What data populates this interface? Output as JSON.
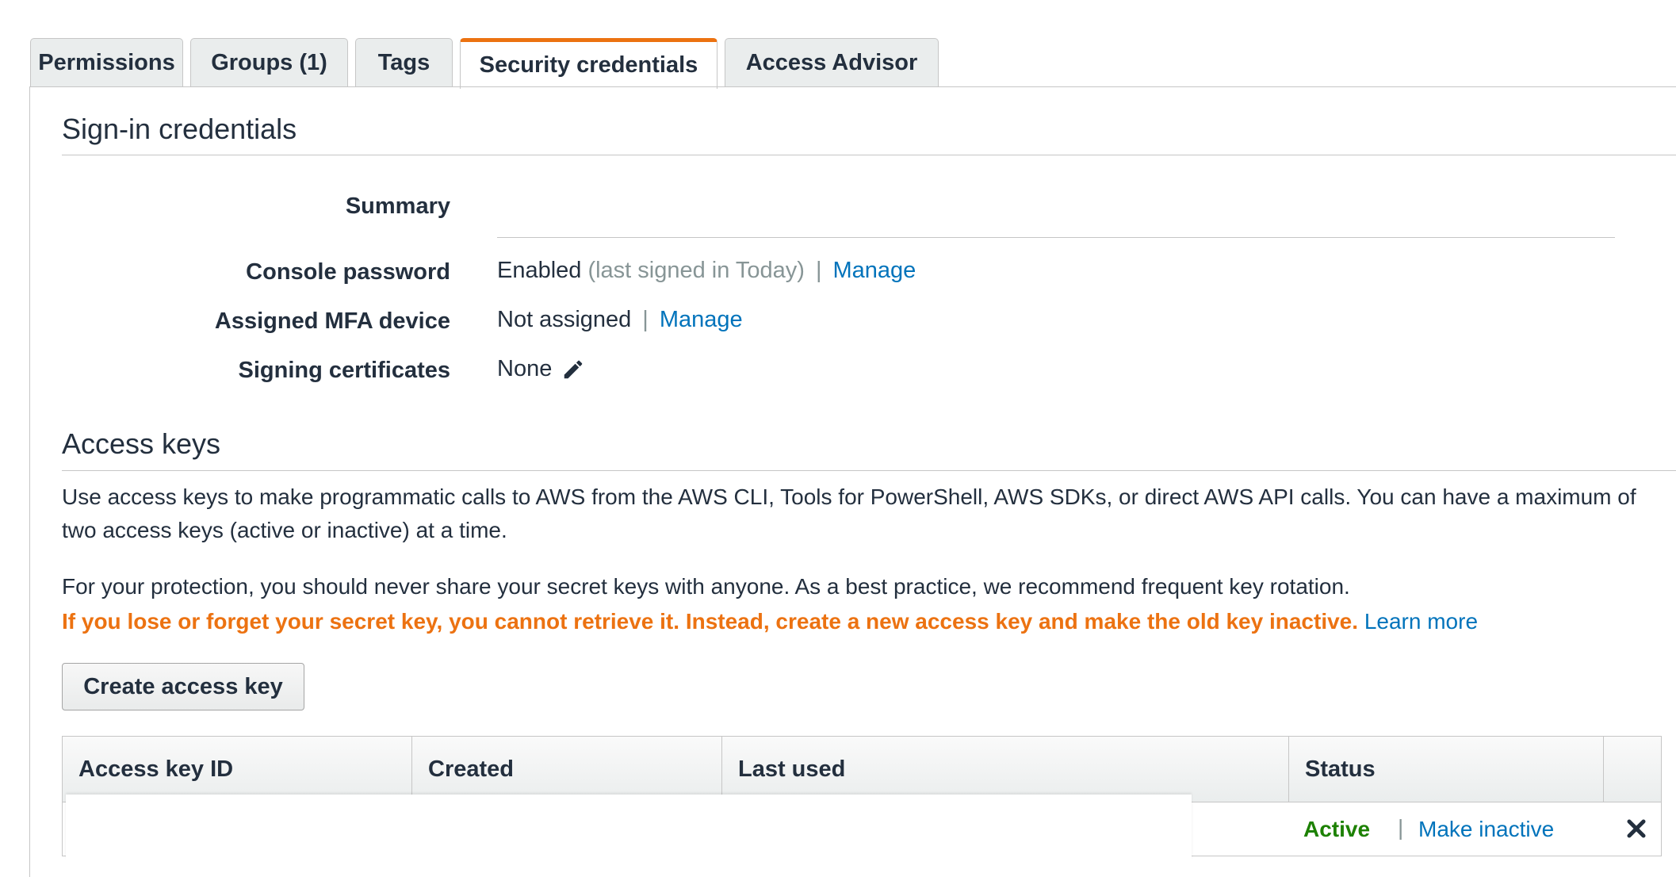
{
  "tabs": [
    {
      "label": "Permissions",
      "active": false
    },
    {
      "label": "Groups (1)",
      "active": false
    },
    {
      "label": "Tags",
      "active": false
    },
    {
      "label": "Security credentials",
      "active": true
    },
    {
      "label": "Access Advisor",
      "active": false
    }
  ],
  "sign_in": {
    "heading": "Sign-in credentials",
    "summary_label": "Summary",
    "console_password": {
      "label": "Console password",
      "value": "Enabled",
      "note": "(last signed in Today)",
      "separator": "|",
      "link": "Manage"
    },
    "mfa": {
      "label": "Assigned MFA device",
      "value": "Not assigned",
      "separator": "|",
      "link": "Manage"
    },
    "signing_certs": {
      "label": "Signing certificates",
      "value": "None",
      "icon": "pencil-icon"
    }
  },
  "access_keys": {
    "heading": "Access keys",
    "description": "Use access keys to make programmatic calls to AWS from the AWS CLI, Tools for PowerShell, AWS SDKs, or direct AWS API calls. You can have a maximum of two access keys (active or inactive) at a time.",
    "protection_note": "For your protection, you should never share your secret keys with anyone. As a best practice, we recommend frequent key rotation.",
    "warning": "If you lose or forget your secret key, you cannot retrieve it. Instead, create a new access key and make the old key inactive.",
    "learn_more": "Learn more",
    "create_button": "Create access key",
    "table": {
      "columns": [
        "Access key ID",
        "Created",
        "Last used",
        "Status",
        ""
      ],
      "rows": [
        {
          "status": "Active",
          "separator": "|",
          "action": "Make inactive",
          "delete_icon": "close-icon"
        }
      ]
    }
  },
  "colors": {
    "accent_tab": "#ec7211",
    "link": "#0073bb",
    "warning": "#ec7211",
    "active": "#1d8102"
  }
}
